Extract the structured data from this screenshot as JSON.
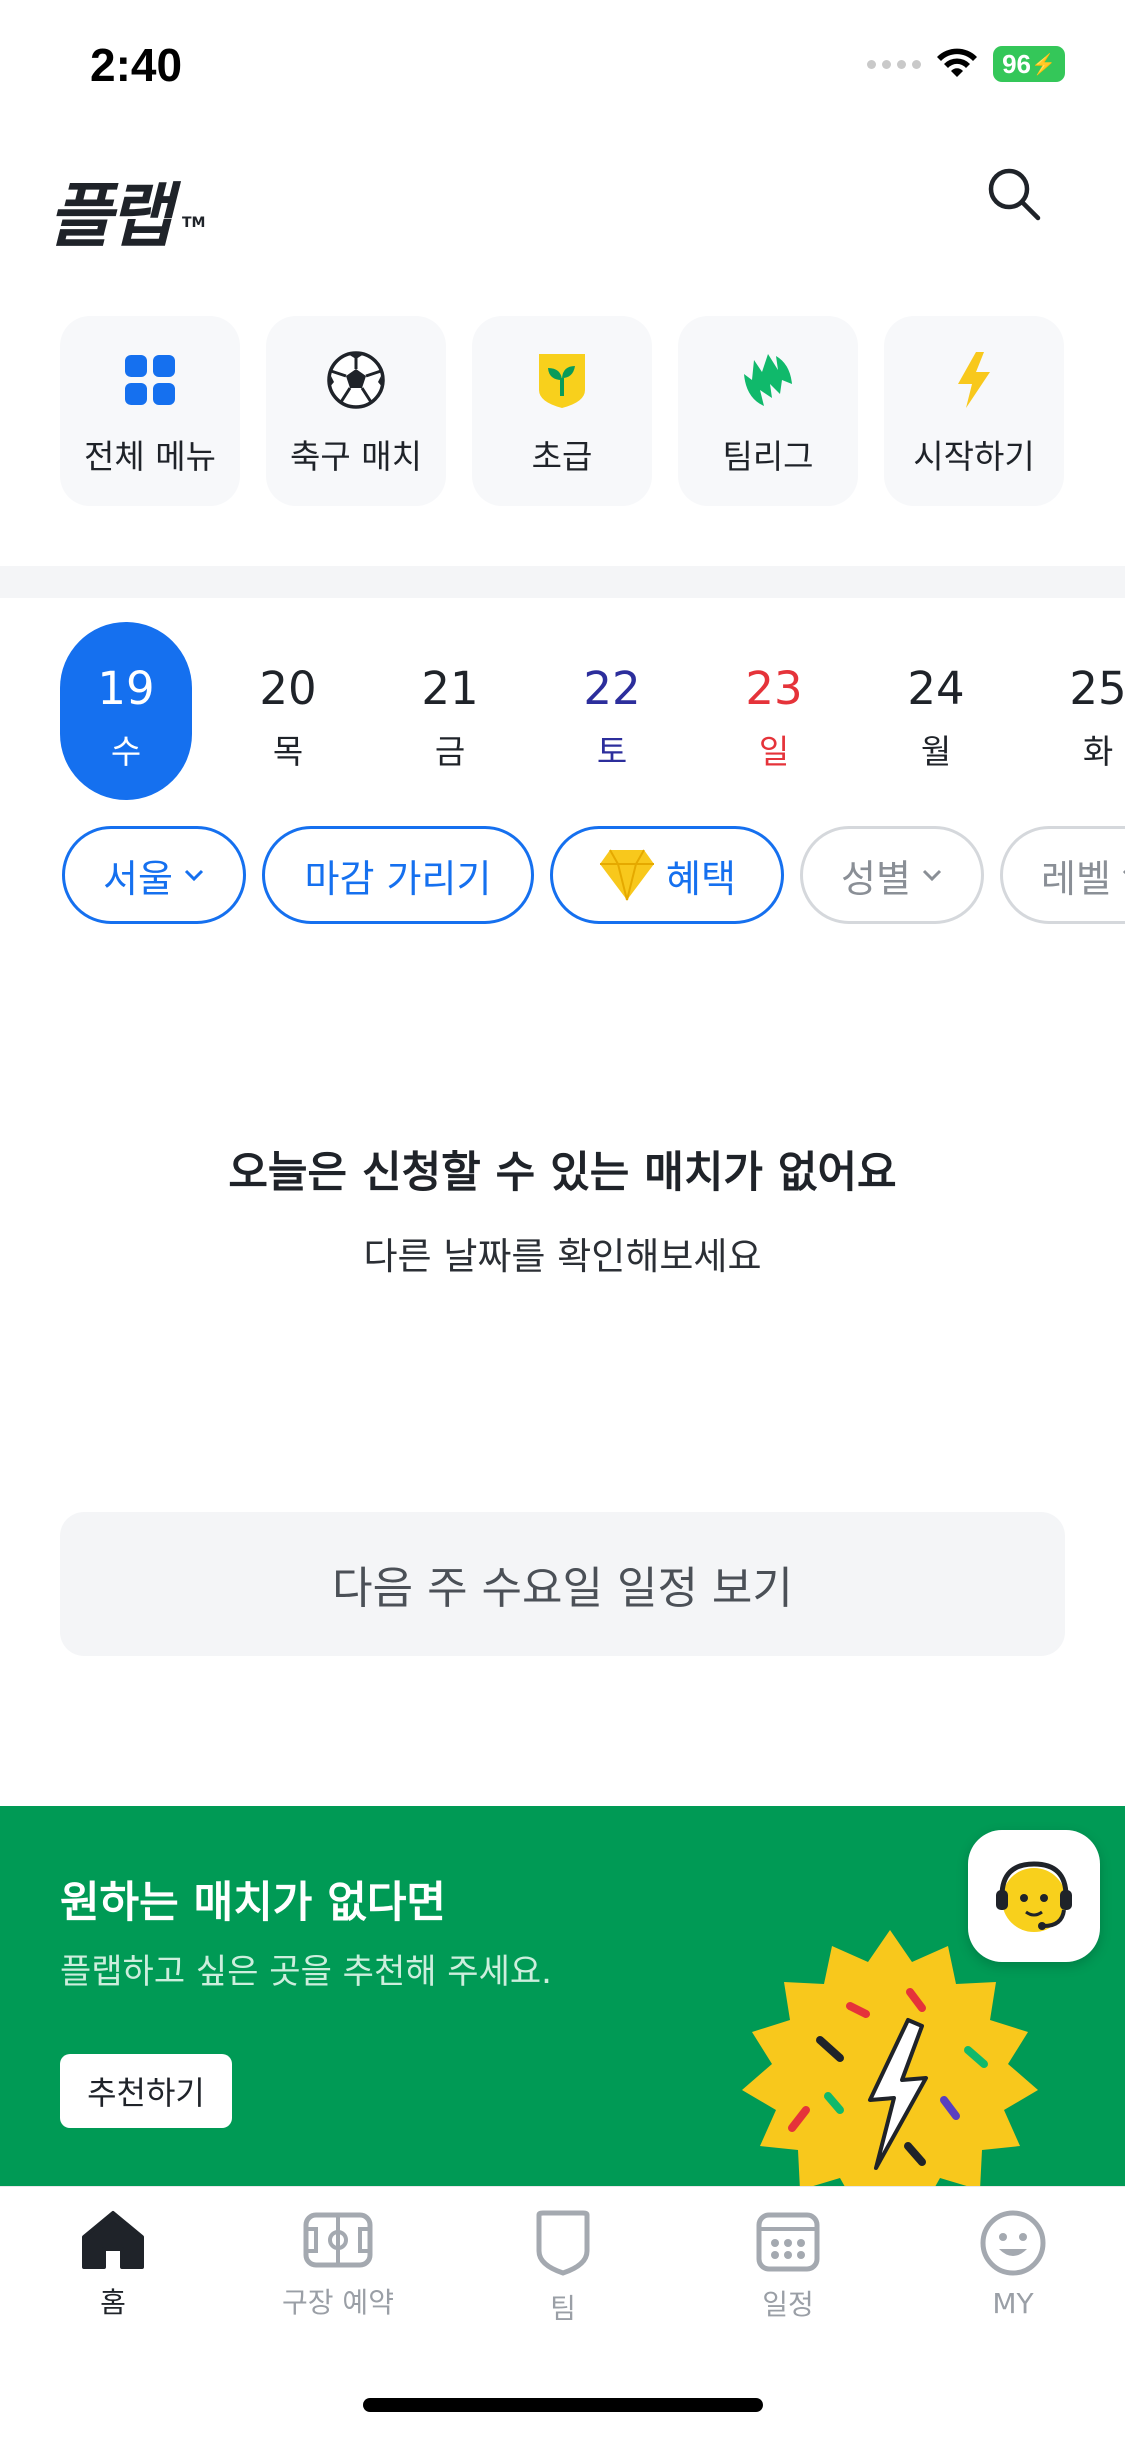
{
  "status_bar": {
    "time": "2:40",
    "battery": "96"
  },
  "header": {
    "logo": "플랩",
    "logo_tm": "TM",
    "search_icon": "search-icon"
  },
  "quick_menu": [
    {
      "label": "전체 메뉴",
      "icon": "grid-icon"
    },
    {
      "label": "축구 매치",
      "icon": "soccer-ball-icon"
    },
    {
      "label": "초급",
      "icon": "sprout-badge-icon"
    },
    {
      "label": "팀리그",
      "icon": "flame-icon"
    },
    {
      "label": "시작하기",
      "icon": "lightning-icon"
    }
  ],
  "dates": [
    {
      "num": "19",
      "day": "수"
    },
    {
      "num": "20",
      "day": "목"
    },
    {
      "num": "21",
      "day": "금"
    },
    {
      "num": "22",
      "day": "토"
    },
    {
      "num": "23",
      "day": "일"
    },
    {
      "num": "24",
      "day": "월"
    },
    {
      "num": "25",
      "day": "화"
    }
  ],
  "filters": [
    {
      "label": "서울"
    },
    {
      "label": "마감 가리기"
    },
    {
      "label": "혜택"
    },
    {
      "label": "성별"
    },
    {
      "label": "레벨"
    }
  ],
  "empty_state": {
    "title": "오늘은 신청할 수 있는 매치가 없어요",
    "subtitle": "다른 날짜를 확인해보세요",
    "next_week_button": "다음 주 수요일 일정 보기"
  },
  "banner": {
    "title": "원하는 매치가 없다면",
    "subtitle": "플랩하고 싶은 곳을 추천해 주세요.",
    "button": "추천하기"
  },
  "tabs": [
    {
      "label": "홈",
      "icon": "home-icon"
    },
    {
      "label": "구장 예약",
      "icon": "stadium-icon"
    },
    {
      "label": "팀",
      "icon": "shield-icon"
    },
    {
      "label": "일정",
      "icon": "calendar-icon"
    },
    {
      "label": "MY",
      "icon": "smiley-icon"
    }
  ],
  "colors": {
    "accent": "#1570ef",
    "banner": "#009a55",
    "saturday": "#2c2e9c",
    "sunday": "#e5333a"
  }
}
